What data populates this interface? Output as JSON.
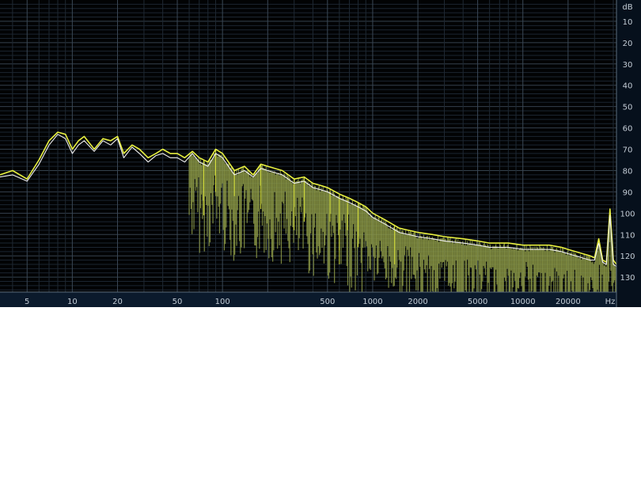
{
  "chart_data": {
    "type": "line",
    "title": "",
    "x_unit": "Hz",
    "y_unit": "dB",
    "x_scale": "log",
    "xlim": [
      3.3,
      42000
    ],
    "ylim": [
      0,
      137
    ],
    "y_inverted": true,
    "x_ticks": [
      5,
      10,
      20,
      50,
      100,
      500,
      1000,
      2000,
      5000,
      10000,
      20000
    ],
    "x_tick_labels": [
      "5",
      "10",
      "20",
      "50",
      "100",
      "500",
      "1000",
      "2000",
      "5000",
      "10000",
      "20000"
    ],
    "y_ticks": [
      10,
      20,
      30,
      40,
      50,
      60,
      70,
      80,
      90,
      100,
      110,
      120,
      130
    ],
    "y_tick_labels": [
      "10",
      "20",
      "30",
      "40",
      "50",
      "60",
      "70",
      "80",
      "90",
      "100",
      "110",
      "120",
      "130"
    ],
    "grid": true,
    "legend": "none",
    "series": [
      {
        "color": "#e8f040",
        "x": [
          3.3,
          4,
          5,
          6,
          7,
          8,
          9,
          10,
          11,
          12,
          14,
          16,
          18,
          20,
          22,
          25,
          28,
          32,
          36,
          40,
          45,
          50,
          56,
          63,
          70,
          80,
          90,
          100,
          120,
          140,
          160,
          180,
          200,
          250,
          300,
          350,
          400,
          450,
          500,
          600,
          700,
          800,
          900,
          1000,
          1200,
          1500,
          2000,
          2500,
          3000,
          4000,
          5000,
          6000,
          8000,
          10000,
          12000,
          15000,
          18000,
          20000,
          25000,
          28000,
          30000,
          32000,
          34000,
          36000,
          38000,
          40000,
          42000
        ],
        "values": [
          82,
          80,
          84,
          75,
          66,
          62,
          63,
          70,
          66,
          64,
          70,
          65,
          66,
          64,
          72,
          68,
          70,
          74,
          72,
          70,
          72,
          72,
          74,
          71,
          74,
          76,
          70,
          72,
          80,
          78,
          82,
          77,
          78,
          80,
          84,
          83,
          86,
          87,
          88,
          91,
          93,
          95,
          97,
          100,
          103,
          107,
          109,
          110,
          111,
          112,
          113,
          114,
          114,
          115,
          115,
          115,
          116,
          117,
          119,
          120,
          121,
          112,
          122,
          123,
          98,
          122,
          124
        ]
      },
      {
        "color": "#f2f2f2",
        "x": [
          3.3,
          4,
          5,
          6,
          7,
          8,
          9,
          10,
          11,
          12,
          14,
          16,
          18,
          20,
          22,
          25,
          28,
          32,
          36,
          40,
          45,
          50,
          56,
          63,
          70,
          80,
          90,
          100,
          120,
          140,
          160,
          180,
          200,
          250,
          300,
          350,
          400,
          450,
          500,
          600,
          700,
          800,
          900,
          1000,
          1200,
          1500,
          2000,
          2500,
          3000,
          4000,
          5000,
          6000,
          8000,
          10000,
          12000,
          15000,
          18000,
          20000,
          25000,
          28000,
          30000,
          32000,
          34000,
          36000,
          38000,
          40000,
          42000
        ],
        "values": [
          83,
          82,
          85,
          77,
          68,
          63,
          65,
          72,
          68,
          66,
          71,
          66,
          68,
          65,
          74,
          69,
          72,
          76,
          73,
          72,
          74,
          74,
          76,
          72,
          76,
          78,
          72,
          74,
          82,
          80,
          83,
          79,
          80,
          82,
          86,
          85,
          88,
          89,
          90,
          93,
          95,
          97,
          99,
          102,
          105,
          109,
          111,
          112,
          113,
          114,
          115,
          116,
          116,
          117,
          117,
          117,
          118,
          119,
          121,
          122,
          122,
          114,
          123,
          124,
          101,
          124,
          125
        ]
      }
    ]
  }
}
